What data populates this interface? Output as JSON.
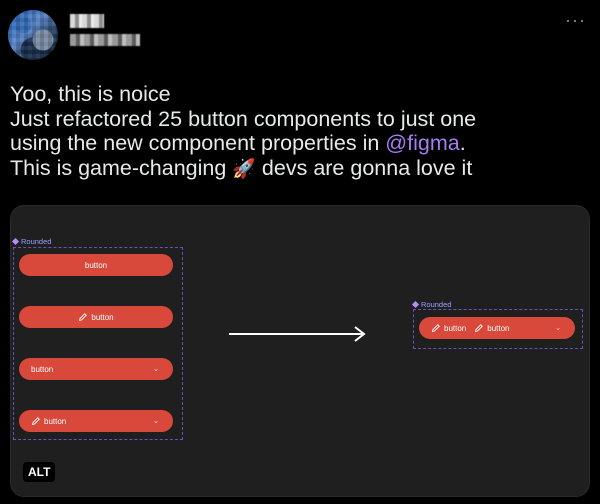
{
  "tweet": {
    "more_label": "···",
    "lines": {
      "l1": "Yoo, this is noice",
      "l2": "Just refactored 25 button components to just one",
      "l3_pre": "using the new component properties in ",
      "l3_mention": "@figma",
      "l3_post": ".",
      "l4_pre": "This is game-changing ",
      "l4_emoji": "🚀",
      "l4_post": " devs are gonna love it"
    }
  },
  "media": {
    "left_frame_label": "Rounded",
    "right_frame_label": "Rounded",
    "buttons": {
      "b1": "button",
      "b2": "button",
      "b3": "button",
      "b4": "button",
      "r1": "button",
      "r2": "button"
    },
    "alt_label": "ALT"
  },
  "colors": {
    "background": "#000000",
    "media_bg": "#1f1f1f",
    "button": "#d8493c",
    "frame_dash": "#6c4fb8",
    "mention": "#a57cf2"
  }
}
